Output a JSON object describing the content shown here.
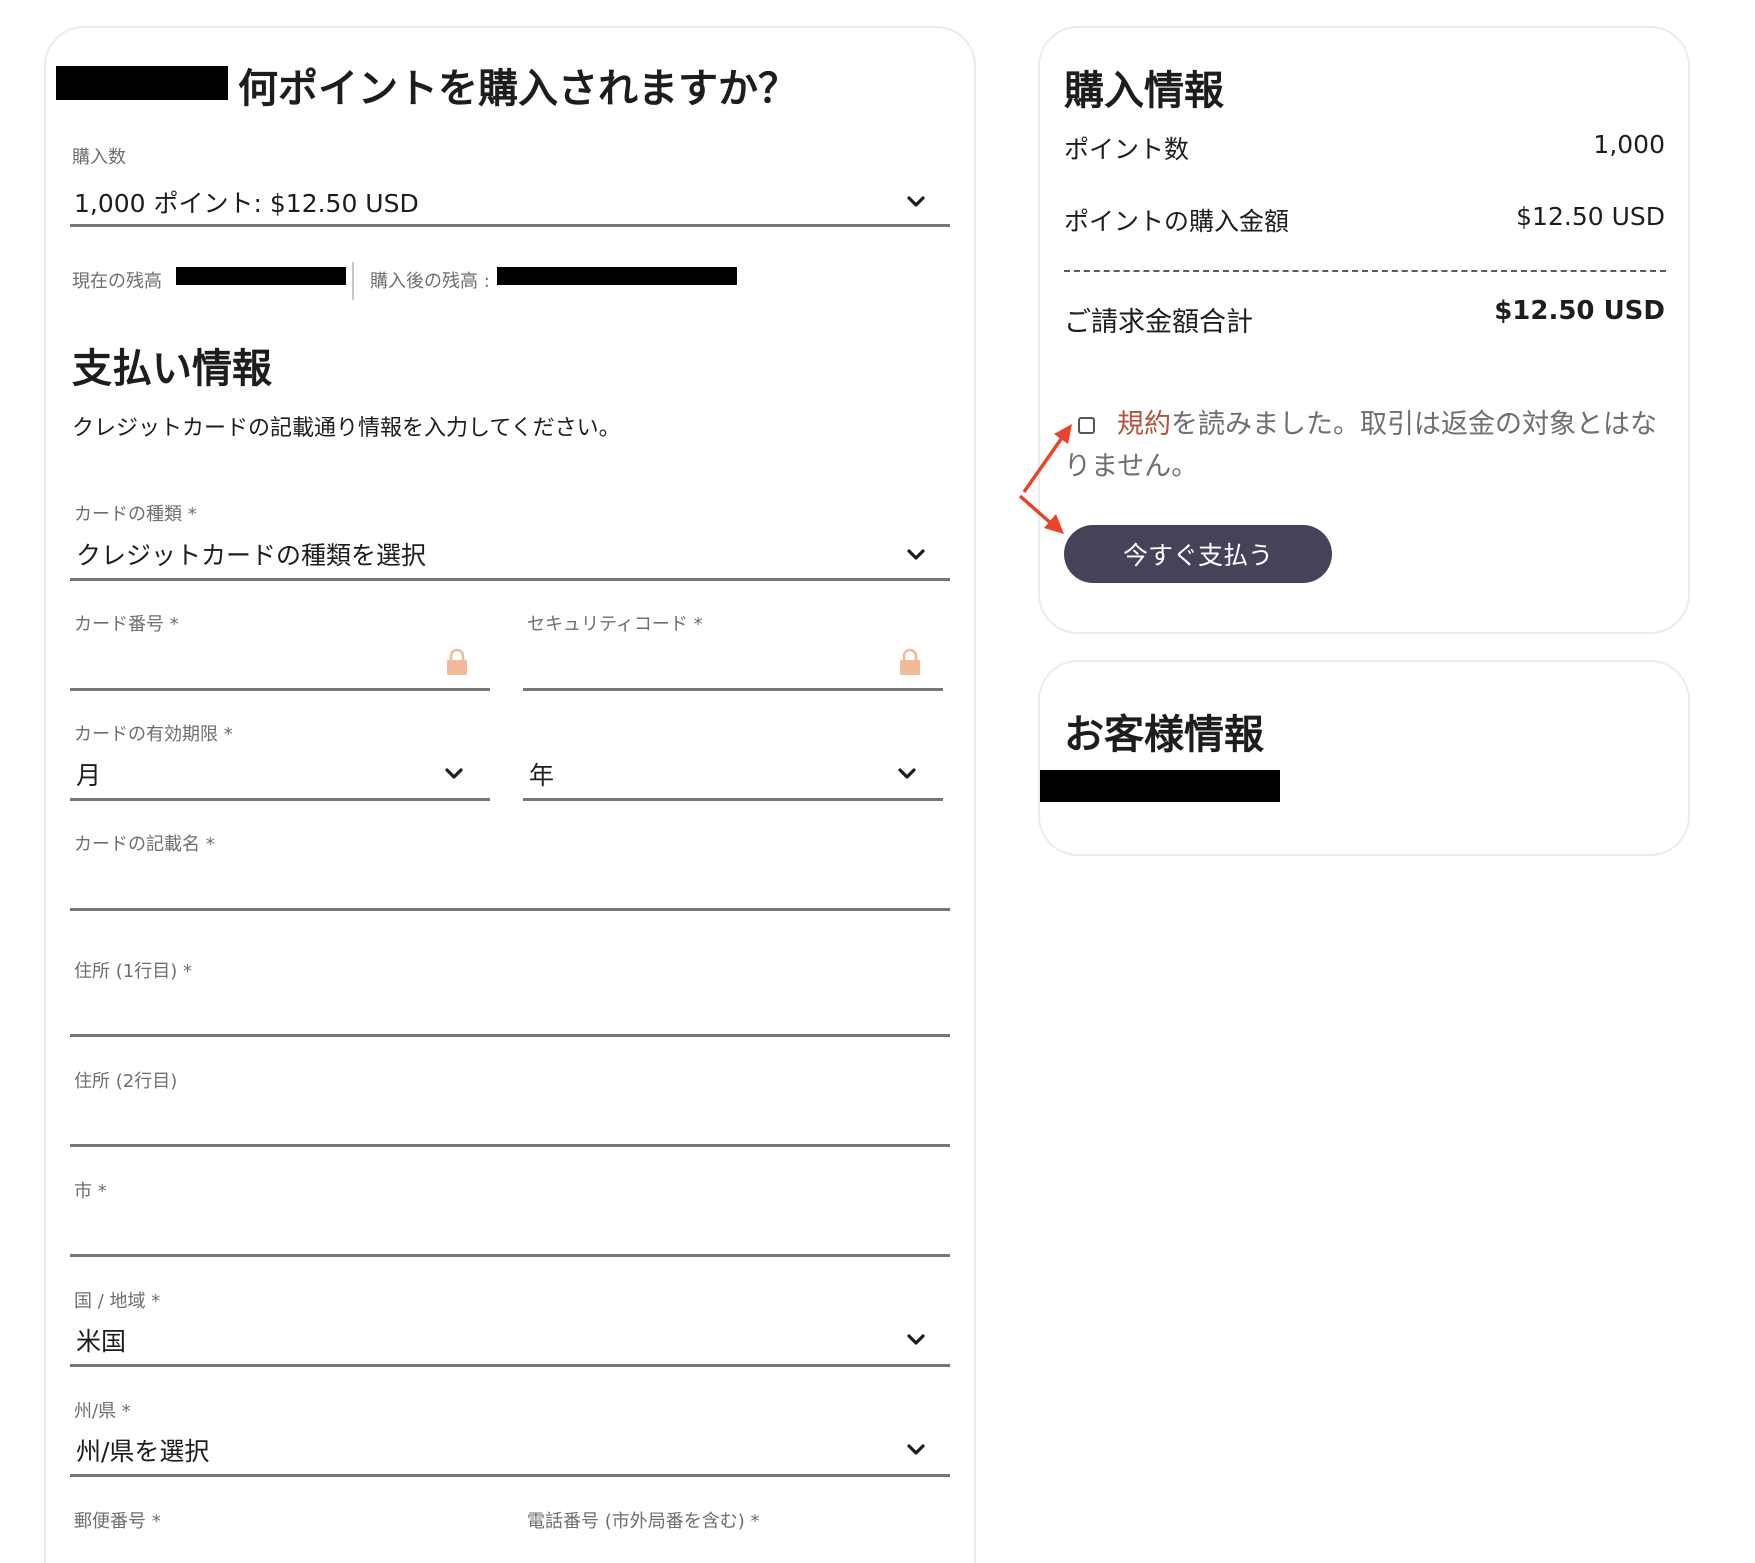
{
  "points_section": {
    "title": "何ポイントを購入されますか？",
    "quantity_label": "購入数",
    "quantity_value": "1,000 ポイント: $12.50 USD",
    "current_balance_label": "現在の残高",
    "after_balance_label": "購入後の残高 :"
  },
  "payment": {
    "title": "支払い情報",
    "description": "クレジットカードの記載通り情報を入力してください。",
    "card_type_label": "カードの種類 *",
    "card_type_value": "クレジットカードの種類を選択",
    "card_number_label": "カード番号 *",
    "security_code_label": "セキュリティコード *",
    "expiry_label": "カードの有効期限 *",
    "month_value": "月",
    "year_value": "年",
    "card_name_label": "カードの記載名 *",
    "address1_label": "住所 (1行目) *",
    "address2_label": "住所 (2行目)",
    "city_label": "市 *",
    "country_label": "国 / 地域 *",
    "country_value": "米国",
    "state_label": "州/県 *",
    "state_value": "州/県を選択",
    "postal_label": "郵便番号 *",
    "phone_label": "電話番号 (市外局番を含む) *"
  },
  "purchase_info": {
    "title": "購入情報",
    "points_label": "ポイント数",
    "points_value": "1,000",
    "price_label": "ポイントの購入金額",
    "price_value": "$12.50 USD",
    "total_label": "ご請求金額合計",
    "total_value": "$12.50 USD",
    "agree_link": "規約",
    "agree_text": "を読みました。取引は返金の対象とはなりません。",
    "pay_button": "今すぐ支払う"
  },
  "customer_info": {
    "title": "お客様情報"
  },
  "colors": {
    "button_bg": "#45435a",
    "link": "#b5533c",
    "lock": "#f2b99b",
    "annotation_arrow": "#e8432b"
  },
  "icons": [
    "chevron-down-icon",
    "lock-icon",
    "arrow-icon"
  ]
}
